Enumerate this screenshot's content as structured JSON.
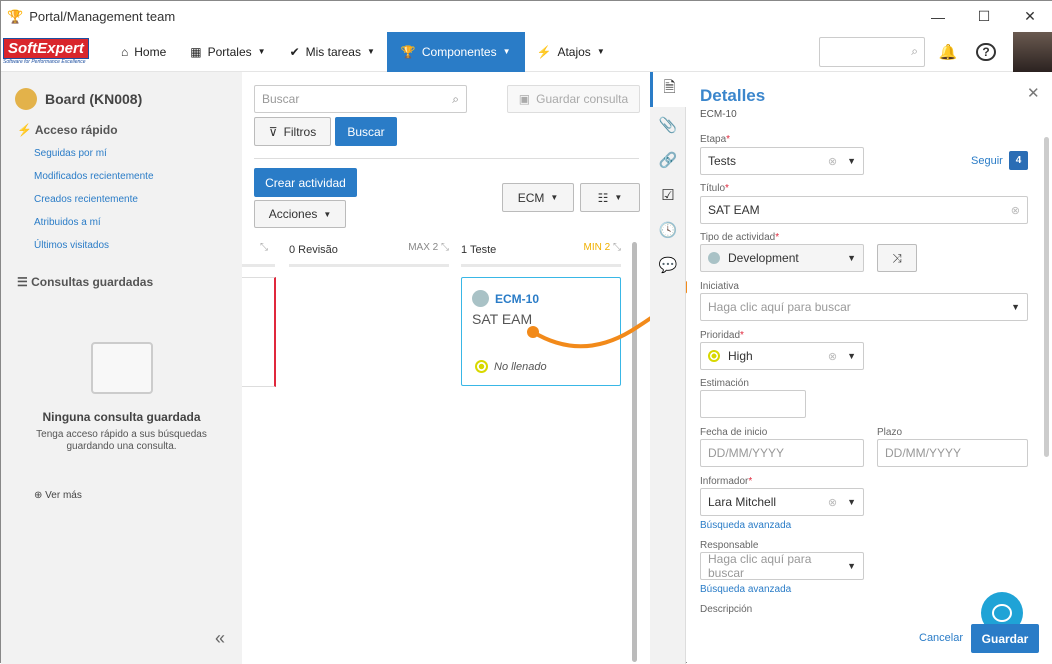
{
  "window": {
    "title": "Portal/Management team",
    "minimize": "—",
    "maximize": "☐",
    "close": "✕"
  },
  "nav": {
    "logo": "SoftExpert",
    "logo_tagline": "Software for Performance Excellence",
    "items": [
      {
        "label": "Home",
        "icon": "⌂"
      },
      {
        "label": "Portales",
        "icon": "▦"
      },
      {
        "label": "Mis tareas",
        "icon": "✔"
      },
      {
        "label": "Componentes",
        "icon": "🏆"
      },
      {
        "label": "Atajos",
        "icon": "⚡"
      }
    ],
    "search_placeholder": ""
  },
  "sidebar": {
    "board_title": "Board (KN008)",
    "quick_access": "Acceso rápido",
    "links": [
      "Seguidas por mí",
      "Modificados recientemente",
      "Creados recientemente",
      "Atribuidos a mí",
      "Últimos visitados"
    ],
    "saved_queries": "Consultas guardadas",
    "empty_title": "Ninguna consulta guardada",
    "empty_text": "Tenga acceso rápido a sus búsquedas guardando una consulta.",
    "see_more": "Ver más",
    "collapse": "«"
  },
  "board": {
    "search_placeholder": "Buscar",
    "save_query": "Guardar consulta",
    "filters": "Filtros",
    "search_button": "Buscar",
    "create_activity": "Crear actividad",
    "actions": "Acciones",
    "ecm_select": "ECM",
    "columns": [
      {
        "title": "0 Revisão",
        "limit": "MAX 2",
        "limit_color": "#888888"
      },
      {
        "title": "1 Teste",
        "limit": "MIN 2",
        "limit_color": "#f0b000"
      }
    ],
    "card": {
      "id": "ECM-10",
      "title": "SAT EAM",
      "status": "No llenado"
    }
  },
  "details": {
    "title": "Detalles",
    "id": "ECM-10",
    "stage_label": "Etapa",
    "stage": "Tests",
    "follow": "Seguir",
    "follow_count": "4",
    "title_label": "Título",
    "title_value": "SAT EAM",
    "type_label": "Tipo de actividad",
    "type_value": "Development",
    "initiative_label": "Iniciativa",
    "initiative_placeholder": "Haga clic aquí para buscar",
    "priority_label": "Prioridad",
    "priority_value": "High",
    "estimate_label": "Estimación",
    "start_label": "Fecha de inicio",
    "start_placeholder": "DD/MM/YYYY",
    "deadline_label": "Plazo",
    "deadline_placeholder": "DD/MM/YYYY",
    "reporter_label": "Informador",
    "reporter_value": "Lara Mitchell",
    "advanced_search": "Búsqueda avanzada",
    "responsible_label": "Responsable",
    "responsible_placeholder": "Haga clic aquí para buscar",
    "description_label": "Descripción",
    "cancel": "Cancelar",
    "save": "Guardar"
  },
  "colors": {
    "accent": "#2a7cc7",
    "arrow": "#f28a1a",
    "required": "#e0283c"
  }
}
